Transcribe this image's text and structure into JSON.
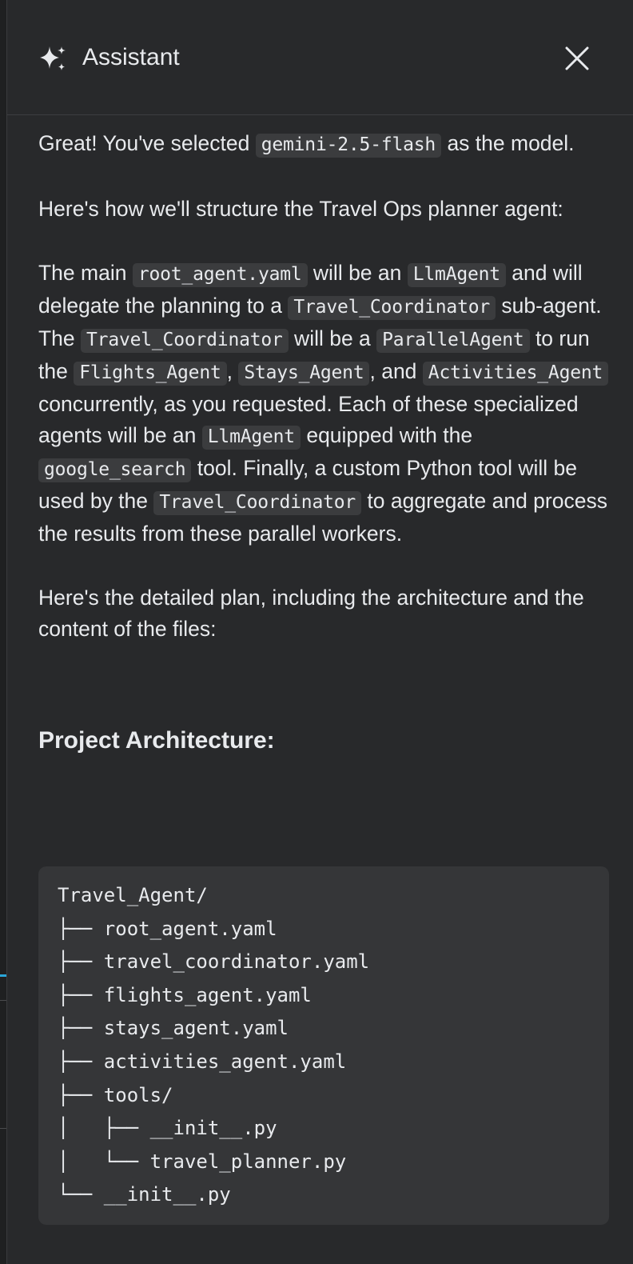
{
  "header": {
    "title": "Assistant",
    "close_icon": "close-icon",
    "sparkle_icon": "sparkle-icon"
  },
  "message": {
    "p1": {
      "t1": "Great! You've selected ",
      "c1": "gemini-2.5-flash",
      "t2": " as the model."
    },
    "p2": "Here's how we'll structure the Travel Ops planner agent:",
    "p3": {
      "t1": "The main ",
      "c1": "root_agent.yaml",
      "t2": " will be an ",
      "c2": "LlmAgent",
      "t3": " and will delegate the planning to a ",
      "c3": "Travel_Coordinator",
      "t4": " sub-agent. The ",
      "c4": "Travel_Coordinator",
      "t5": " will be a ",
      "c5": "ParallelAgent",
      "t6": " to run the ",
      "c6": "Flights_Agent",
      "t7": ", ",
      "c7": "Stays_Agent",
      "t8": ", and ",
      "c8": "Activities_Agent",
      "t9": " concurrently, as you requested. Each of these specialized agents will be an ",
      "c9": "LlmAgent",
      "t10": " equipped with the ",
      "c10": "google_search",
      "t11": " tool. Finally, a custom Python tool will be used by the ",
      "c11": "Travel_Coordinator",
      "t12": " to aggregate and process the results from these parallel workers."
    },
    "p4": "Here's the detailed plan, including the architecture and the content of the files:",
    "section_heading": "Project Architecture:",
    "code_lines": [
      "Travel_Agent/",
      "├── root_agent.yaml",
      "├── travel_coordinator.yaml",
      "├── flights_agent.yaml",
      "├── stays_agent.yaml",
      "├── activities_agent.yaml",
      "├── tools/",
      "│   ├── __init__.py",
      "│   └── travel_planner.py",
      "└── __init__.py"
    ]
  },
  "colors": {
    "background": "#28292b",
    "text": "#e8eaed",
    "inline_code_bg": "#3b3c3e",
    "code_block_bg": "#353638",
    "accent": "#2aa6d8"
  }
}
